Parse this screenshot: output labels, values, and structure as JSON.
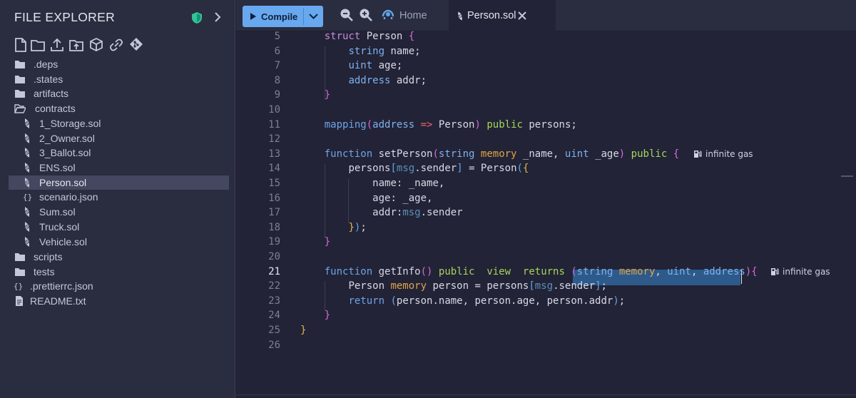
{
  "sidebar": {
    "title": "FILE EXPLORER",
    "tree": [
      {
        "label": ".deps",
        "type": "folder"
      },
      {
        "label": ".states",
        "type": "folder"
      },
      {
        "label": "artifacts",
        "type": "folder"
      },
      {
        "label": "contracts",
        "type": "folder-open"
      },
      {
        "label": "1_Storage.sol",
        "type": "sol"
      },
      {
        "label": "2_Owner.sol",
        "type": "sol"
      },
      {
        "label": "3_Ballot.sol",
        "type": "sol"
      },
      {
        "label": "ENS.sol",
        "type": "sol"
      },
      {
        "label": "Person.sol",
        "type": "sol",
        "selected": true
      },
      {
        "label": "scenario.json",
        "type": "json"
      },
      {
        "label": "Sum.sol",
        "type": "sol"
      },
      {
        "label": "Truck.sol",
        "type": "sol"
      },
      {
        "label": "Vehicle.sol",
        "type": "sol"
      },
      {
        "label": "scripts",
        "type": "folder"
      },
      {
        "label": "tests",
        "type": "folder"
      },
      {
        "label": ".prettierrc.json",
        "type": "json"
      },
      {
        "label": "README.txt",
        "type": "file"
      }
    ]
  },
  "toolbar": {
    "compile_label": "Compile"
  },
  "tabs": {
    "home_label": "Home",
    "active_label": "Person.sol"
  },
  "editor": {
    "active_line": 21,
    "gas_label": "infinite gas",
    "lines": [
      {
        "n": "5",
        "tokens": [
          [
            "    ",
            ""
          ],
          [
            "struct",
            "kw2"
          ],
          [
            " Person ",
            ""
          ],
          [
            "{",
            "br2"
          ]
        ]
      },
      {
        "n": "6",
        "tokens": [
          [
            "        ",
            ""
          ],
          [
            "string",
            "ty"
          ],
          [
            " name;",
            ""
          ]
        ]
      },
      {
        "n": "7",
        "tokens": [
          [
            "        ",
            ""
          ],
          [
            "uint",
            "ty"
          ],
          [
            " age;",
            ""
          ]
        ]
      },
      {
        "n": "8",
        "tokens": [
          [
            "        ",
            ""
          ],
          [
            "address",
            "ty"
          ],
          [
            " addr;",
            ""
          ]
        ]
      },
      {
        "n": "9",
        "tokens": [
          [
            "    ",
            ""
          ],
          [
            "}",
            "br2"
          ]
        ]
      },
      {
        "n": "10",
        "tokens": []
      },
      {
        "n": "11",
        "tokens": [
          [
            "    ",
            ""
          ],
          [
            "mapping",
            "kw"
          ],
          [
            "(",
            "br2"
          ],
          [
            "address",
            "ty"
          ],
          [
            " ",
            ""
          ],
          [
            "=>",
            "op"
          ],
          [
            " Person",
            ""
          ],
          [
            ")",
            "br2"
          ],
          [
            " ",
            ""
          ],
          [
            "public",
            "pub"
          ],
          [
            " persons;",
            ""
          ]
        ]
      },
      {
        "n": "12",
        "tokens": []
      },
      {
        "n": "13",
        "tokens": [
          [
            "    ",
            ""
          ],
          [
            "function",
            "kw"
          ],
          [
            " setPerson",
            ""
          ],
          [
            "(",
            "br2"
          ],
          [
            "string",
            "ty"
          ],
          [
            " ",
            ""
          ],
          [
            "memory",
            "mem"
          ],
          [
            " _name, ",
            ""
          ],
          [
            "uint",
            "ty"
          ],
          [
            " _age",
            ""
          ],
          [
            ")",
            "br2"
          ],
          [
            " ",
            ""
          ],
          [
            "public",
            "pub"
          ],
          [
            " ",
            ""
          ],
          [
            "{",
            "br2"
          ]
        ]
      },
      {
        "n": "14",
        "tokens": [
          [
            "        ",
            ""
          ],
          [
            "persons",
            ""
          ],
          [
            "[",
            "br3"
          ],
          [
            "msg",
            "msg"
          ],
          [
            ".sender",
            ""
          ],
          [
            "]",
            "br3"
          ],
          [
            " = Person",
            ""
          ],
          [
            "(",
            "br3"
          ],
          [
            "{",
            "br1"
          ]
        ]
      },
      {
        "n": "15",
        "tokens": [
          [
            "            ",
            ""
          ],
          [
            "name: _name,",
            ""
          ]
        ]
      },
      {
        "n": "16",
        "tokens": [
          [
            "            ",
            ""
          ],
          [
            "age: _age,",
            ""
          ]
        ]
      },
      {
        "n": "17",
        "tokens": [
          [
            "            ",
            ""
          ],
          [
            "addr:",
            ""
          ],
          [
            "msg",
            "msg"
          ],
          [
            ".sender",
            ""
          ]
        ]
      },
      {
        "n": "18",
        "tokens": [
          [
            "        ",
            ""
          ],
          [
            "}",
            "br1"
          ],
          [
            ")",
            "br3"
          ],
          [
            ";",
            ""
          ]
        ]
      },
      {
        "n": "19",
        "tokens": [
          [
            "    ",
            ""
          ],
          [
            "}",
            "br2"
          ]
        ]
      },
      {
        "n": "20",
        "tokens": []
      },
      {
        "n": "21",
        "tokens": [
          [
            "    ",
            ""
          ],
          [
            "function",
            "kw"
          ],
          [
            " getInfo",
            ""
          ],
          [
            "()",
            "br2"
          ],
          [
            " ",
            ""
          ],
          [
            "public",
            "pub"
          ],
          [
            "  ",
            ""
          ],
          [
            "view",
            "pub"
          ],
          [
            "  ",
            ""
          ],
          [
            "returns",
            "pub"
          ],
          [
            " ",
            ""
          ],
          [
            "(",
            "br2"
          ],
          [
            "string",
            "ty"
          ],
          [
            " ",
            ""
          ],
          [
            "memory",
            "mem"
          ],
          [
            ", ",
            ""
          ],
          [
            "uint",
            "ty"
          ],
          [
            ", ",
            ""
          ],
          [
            "address",
            "ty"
          ],
          [
            ")",
            "br2"
          ],
          [
            "{",
            "br2"
          ]
        ]
      },
      {
        "n": "22",
        "tokens": [
          [
            "        ",
            ""
          ],
          [
            "Person ",
            ""
          ],
          [
            "memory",
            "mem"
          ],
          [
            " person = persons",
            ""
          ],
          [
            "[",
            "br3"
          ],
          [
            "msg",
            "msg"
          ],
          [
            ".sender",
            ""
          ],
          [
            "]",
            "br3"
          ],
          [
            ";",
            ""
          ]
        ]
      },
      {
        "n": "23",
        "tokens": [
          [
            "        ",
            ""
          ],
          [
            "return",
            "kw"
          ],
          [
            " ",
            ""
          ],
          [
            "(",
            "br3"
          ],
          [
            "person.name, person.age, person.addr",
            ""
          ],
          [
            ")",
            "br3"
          ],
          [
            ";",
            ""
          ]
        ]
      },
      {
        "n": "24",
        "tokens": [
          [
            "    ",
            ""
          ],
          [
            "}",
            "br2"
          ]
        ]
      },
      {
        "n": "25",
        "tokens": [
          [
            "",
            ""
          ],
          [
            "}",
            "br1"
          ]
        ]
      },
      {
        "n": "26",
        "tokens": []
      }
    ]
  }
}
